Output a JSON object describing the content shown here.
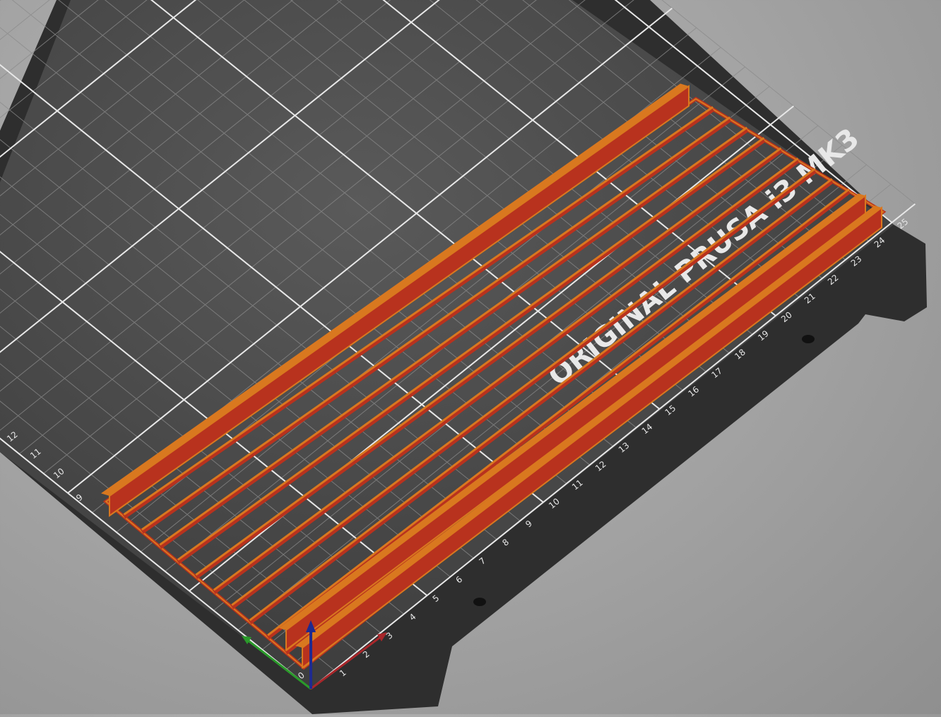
{
  "scene": {
    "bed_brand_text": "ORIGINAL PRUSA i3 MK3",
    "x_axis_ticks": [
      "1",
      "2",
      "3",
      "4",
      "5",
      "6",
      "7",
      "8",
      "9",
      "10",
      "11",
      "12",
      "13",
      "14",
      "15",
      "16",
      "17",
      "18",
      "19",
      "20",
      "21",
      "22",
      "23",
      "24",
      "25"
    ],
    "y_axis_ticks": [
      "9",
      "10",
      "11",
      "12"
    ],
    "origin_label": "0"
  },
  "colors": {
    "bed_plate": "#2f2f2f",
    "bed_surface": "#4a4a4a",
    "grid_line": "#8a8a8a",
    "grid_major": "#e6e6e6",
    "model_orange": "#d9781f",
    "model_red": "#b8321e",
    "x_axis": "#a8262a",
    "y_axis": "#2a9a2a",
    "z_axis": "#1f2a8f"
  },
  "icons": {
    "axis_gizmo": "xyz-axis-gizmo-icon"
  }
}
